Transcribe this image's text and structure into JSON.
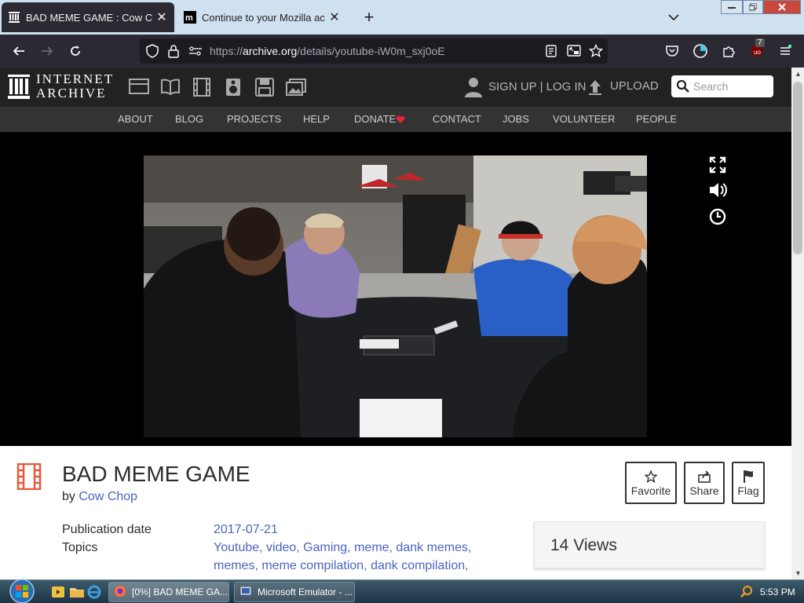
{
  "browser": {
    "tabs": [
      {
        "title": "BAD MEME GAME : Cow Chop",
        "active": true
      },
      {
        "title": "Continue to your Mozilla account",
        "active": false
      }
    ],
    "url_prefix": "https://",
    "url_host": "archive.org",
    "url_path": "/details/youtube-iW0m_sxj0oE",
    "extension_badge": "7"
  },
  "ia": {
    "logo_line1": "INTERNET",
    "logo_line2": "ARCHIVE",
    "media_icons": [
      "web-icon",
      "texts-icon",
      "video-icon",
      "audio-icon",
      "software-icon",
      "images-icon"
    ],
    "signup_login": "SIGN UP | LOG IN",
    "upload": "UPLOAD",
    "search_placeholder": "Search",
    "subnav": [
      "ABOUT",
      "BLOG",
      "PROJECTS",
      "HELP",
      "DONATE",
      "CONTACT",
      "JOBS",
      "VOLUNTEER",
      "PEOPLE"
    ]
  },
  "item": {
    "title": "BAD MEME GAME",
    "by_prefix": "by",
    "creator": "Cow Chop",
    "actions": [
      "Favorite",
      "Share",
      "Flag"
    ],
    "publication_date_label": "Publication date",
    "publication_date": "2017-07-21",
    "topics_label": "Topics",
    "topics_line1": "Youtube, video, Gaming, meme, dank memes,",
    "topics_line2": "memes, meme compilation, dank compilation,",
    "views": "14 Views"
  },
  "taskbar": {
    "tasks": [
      {
        "title": "[0%] BAD MEME GA...",
        "active": true
      },
      {
        "title": "Microsoft Emulator - ...",
        "active": false
      }
    ],
    "clock": "5:53 PM"
  },
  "colors": {
    "link": "#4b64c1",
    "ia_header": "#222222",
    "ia_subnav": "#333333",
    "film_icon": "#e35b3c",
    "donate_heart": "#e0263a"
  }
}
